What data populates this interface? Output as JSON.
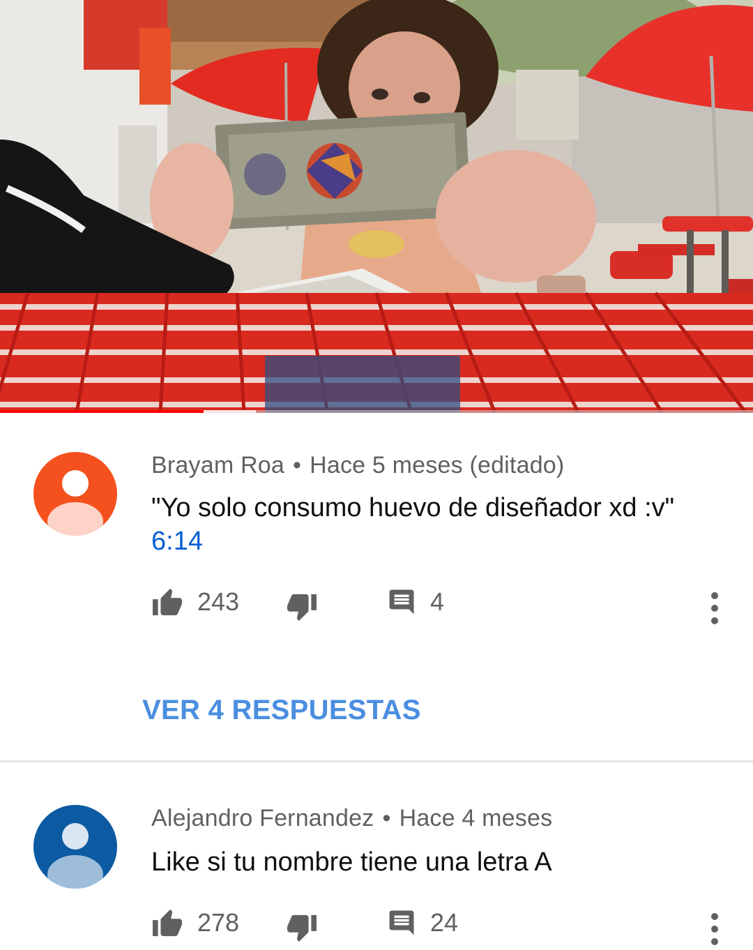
{
  "video": {
    "progress_percent": 27,
    "buffered_percent": 34
  },
  "comments": [
    {
      "author": "Brayam Roa",
      "separator": "•",
      "time": "Hace 5 meses (editado)",
      "text": "\"Yo solo consumo huevo de diseñador xd :v\" ",
      "timestamp_link": "6:14",
      "likes": "243",
      "replies_count": "4",
      "view_replies_label": "VER 4 RESPUESTAS",
      "avatar_color": "#f4511e",
      "avatar_icon": "person-icon"
    },
    {
      "author": "Alejandro Fernandez",
      "separator": "•",
      "time": "Hace 4 meses",
      "text": "Like si tu nombre tiene una letra A",
      "likes": "278",
      "replies_count": "24",
      "avatar_color": "#0b5aa2",
      "avatar_icon": "person-icon"
    }
  ],
  "icons": {
    "like": "thumbs-up-icon",
    "dislike": "thumbs-down-icon",
    "reply": "comment-icon",
    "more": "more-vert-icon"
  },
  "colors": {
    "link_blue": "#065fd4",
    "replies_blue": "#4a8ee0",
    "progress_red": "#ff0000",
    "secondary_text": "#606060"
  }
}
